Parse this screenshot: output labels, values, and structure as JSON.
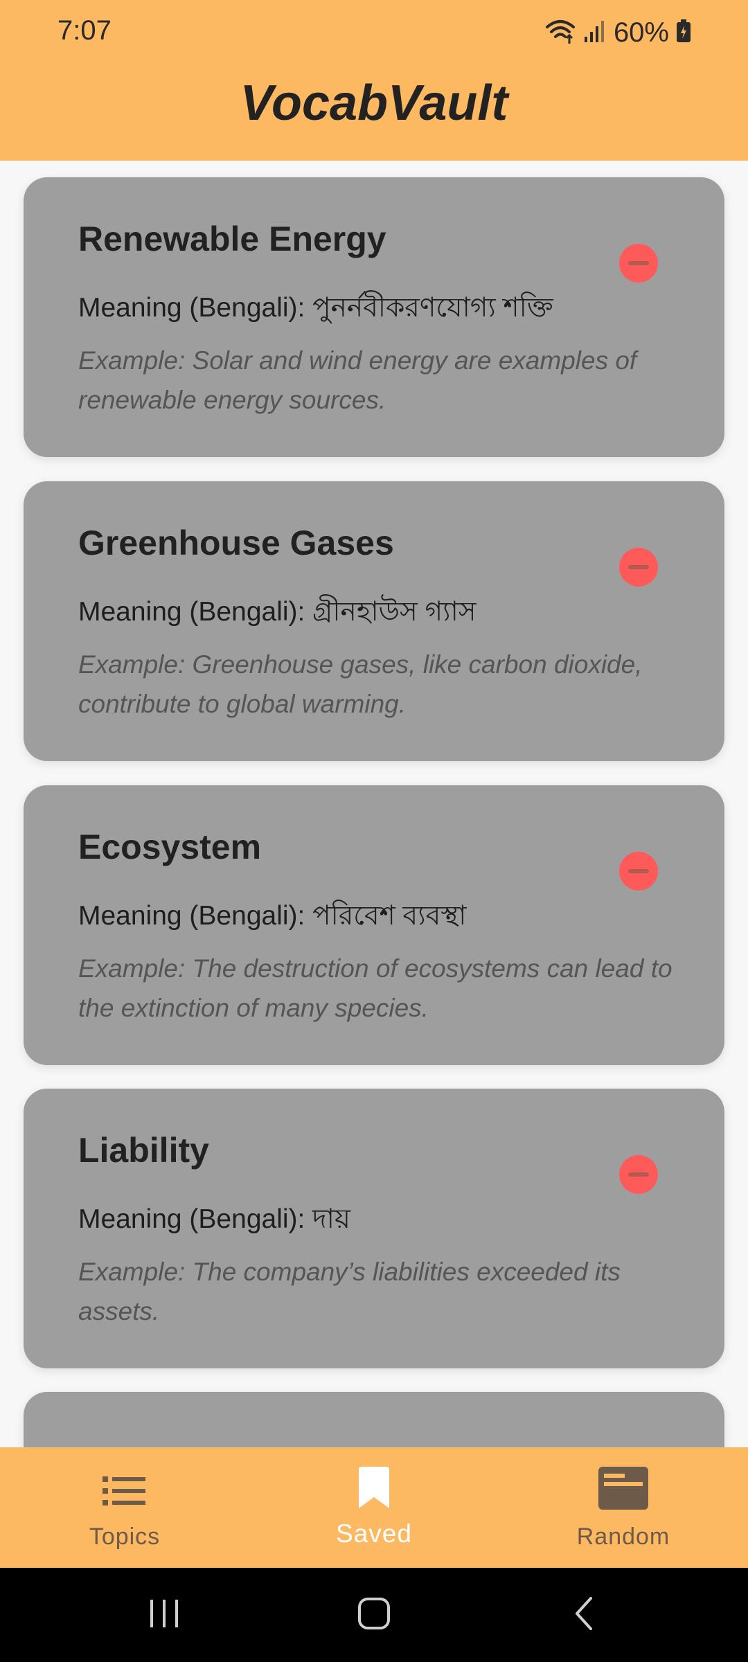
{
  "status": {
    "time": "7:07",
    "battery": "60%"
  },
  "app": {
    "title": "VocabVault"
  },
  "cards": [
    {
      "word": "Renewable Energy",
      "meaning": "Meaning (Bengali): পুনর্নবীকরণযোগ্য শক্তি",
      "example": "Example: Solar and wind energy are examples of renewable energy sources."
    },
    {
      "word": "Greenhouse Gases",
      "meaning": "Meaning (Bengali): গ্রীনহাউস গ্যাস",
      "example": "Example: Greenhouse gases, like carbon dioxide, contribute to global warming."
    },
    {
      "word": "Ecosystem",
      "meaning": "Meaning (Bengali): পরিবেশ ব্যবস্থা",
      "example": "Example: The destruction of ecosystems can lead to the extinction of many species."
    },
    {
      "word": "Liability",
      "meaning": "Meaning (Bengali): দায়",
      "example": "Example: The company’s liabilities exceeded its assets."
    }
  ],
  "nav": {
    "items": [
      {
        "label": "Topics",
        "icon": "list-icon"
      },
      {
        "label": "Saved",
        "icon": "bookmark-icon"
      },
      {
        "label": "Random",
        "icon": "card-icon"
      }
    ],
    "active": "Saved"
  },
  "colors": {
    "accent": "#fdb862",
    "card": "#9e9e9e",
    "remove": "#ff5a5a"
  }
}
